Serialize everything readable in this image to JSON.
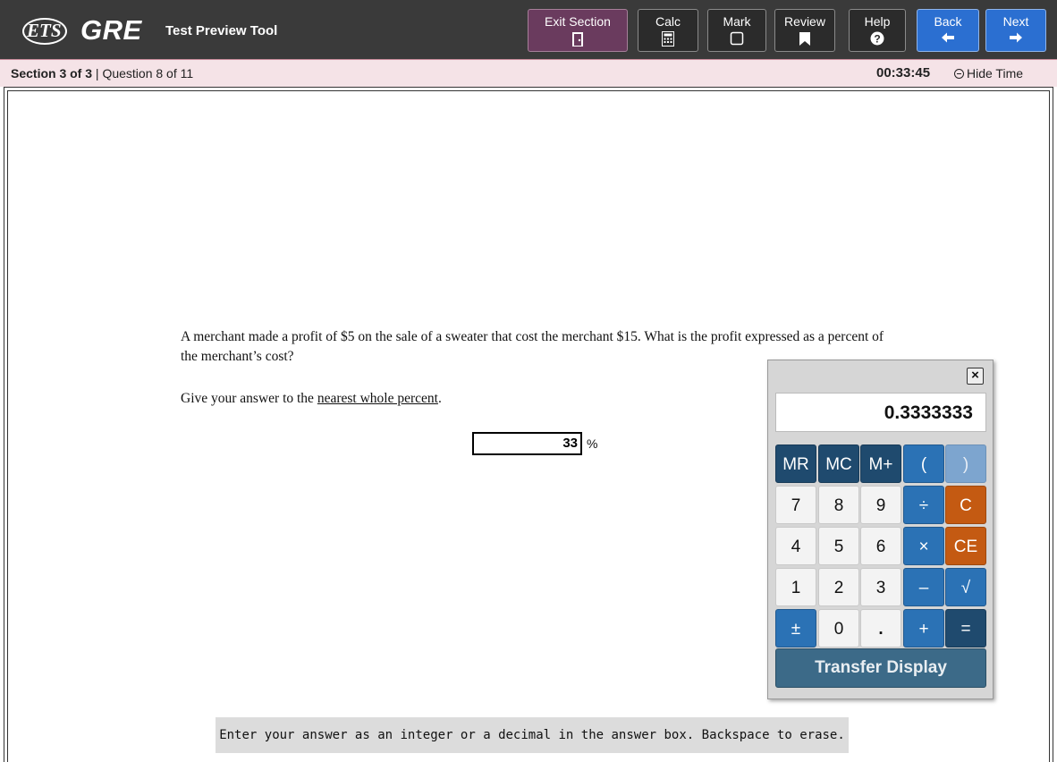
{
  "header": {
    "ets_logo": "ETS",
    "gre_logo": "GRE",
    "tool_title": "Test Preview Tool",
    "buttons": {
      "exit_section": "Exit Section",
      "calc": "Calc",
      "mark": "Mark",
      "review": "Review",
      "help": "Help",
      "back": "Back",
      "next": "Next"
    }
  },
  "status": {
    "section": "Section 3 of 3",
    "separator": " | ",
    "question": "Question 8 of 11",
    "timer": "00:33:45",
    "hide_time": "Hide Time"
  },
  "question": {
    "stem": "A merchant made a profit of $5 on the sale of a sweater that cost the merchant $15. What is the profit expressed as a percent of the merchant’s cost?",
    "instruction_prefix": "Give your answer to the ",
    "instruction_underlined": "nearest whole percent",
    "instruction_suffix": ".",
    "answer_value": "33",
    "unit": "%"
  },
  "hint": "Enter your answer as an integer or a decimal in the answer box. Backspace to erase.",
  "calculator": {
    "close": "×",
    "display": "0.3333333",
    "keys": {
      "mr": "MR",
      "mc": "MC",
      "mplus": "M+",
      "lparen": "(",
      "rparen": ")",
      "k7": "7",
      "k8": "8",
      "k9": "9",
      "div": "÷",
      "c": "C",
      "k4": "4",
      "k5": "5",
      "k6": "6",
      "mul": "×",
      "ce": "CE",
      "k1": "1",
      "k2": "2",
      "k3": "3",
      "minus": "–",
      "sqrt": "√",
      "pm": "±",
      "k0": "0",
      "dot": ".",
      "plus": "+",
      "eq": "="
    },
    "transfer": "Transfer Display"
  },
  "colors": {
    "header_bg": "#3a3a3a",
    "exit_bg": "#6a3b5e",
    "nav_blue": "#2b6fd1",
    "status_bg": "#f5e3e7",
    "calc_clear": "#c45a12"
  }
}
